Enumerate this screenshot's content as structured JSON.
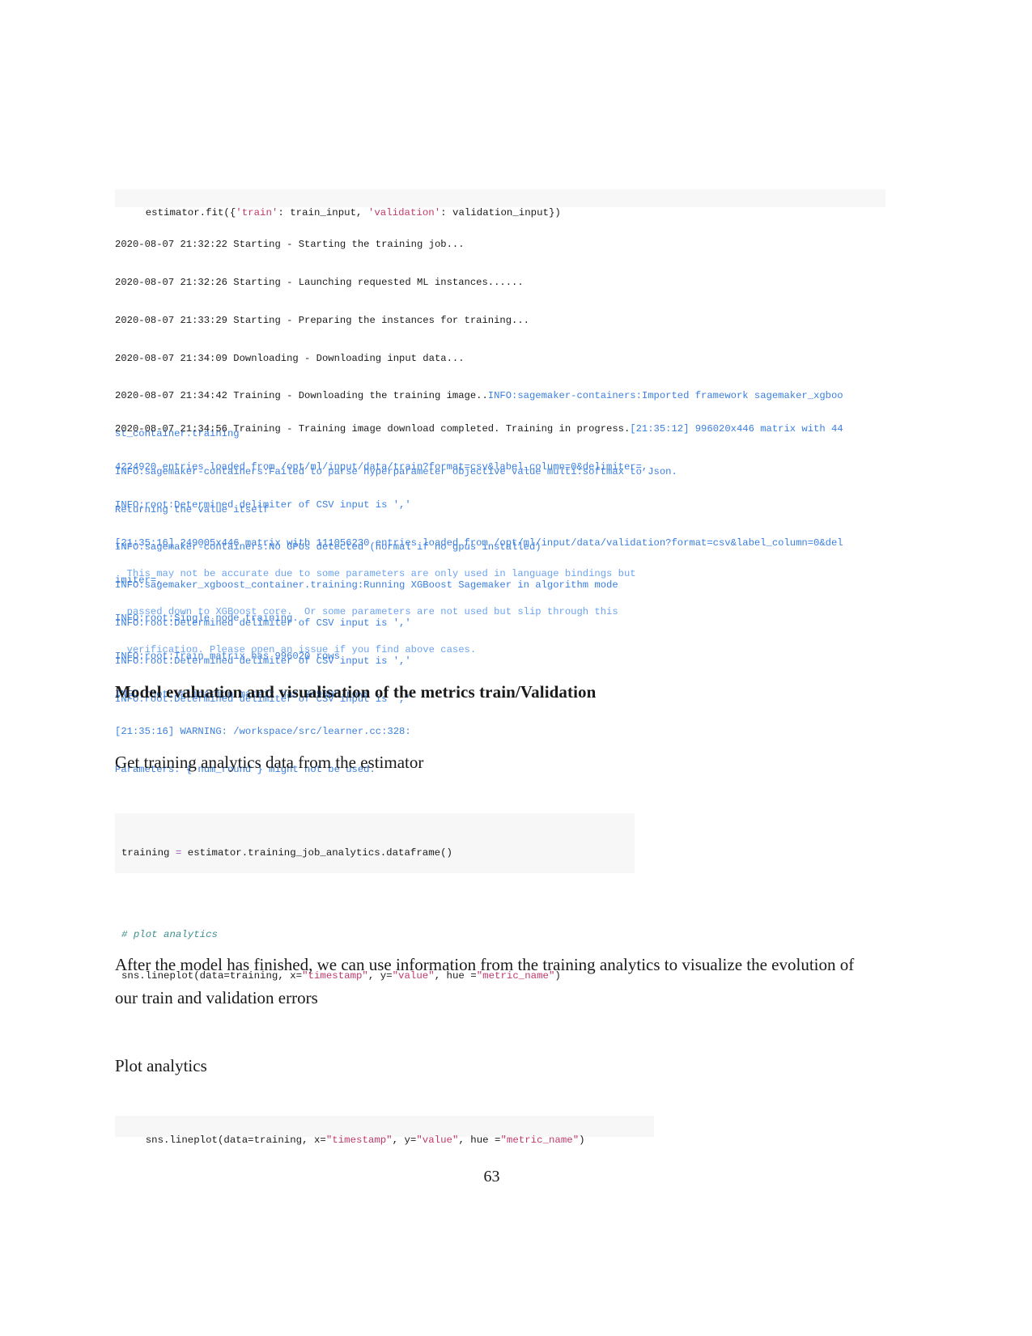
{
  "document": {
    "page_number": "63"
  },
  "cells": {
    "fit_call": {
      "tok_a": "estimator.fit({",
      "tok_train": "'train'",
      "tok_b": ": train_input, ",
      "tok_validation": "'validation'",
      "tok_c": ": validation_input})"
    },
    "analytics": {
      "line1_a": "training ",
      "line1_op": "=",
      "line1_b": " estimator.training_job_analytics.dataframe()",
      "comment": "# plot analytics",
      "line3_a": "sns.lineplot(data=training, x=",
      "line3_s1": "\"timestamp\"",
      "line3_b": ", y=",
      "line3_s2": "\"value\"",
      "line3_c": ", hue =",
      "line3_s3": "\"metric_name\"",
      "line3_d": ")"
    },
    "lineplot": {
      "a": "sns.lineplot(data=training, x=",
      "s1": "\"timestamp\"",
      "b": ", y=",
      "s2": "\"value\"",
      "c": ", hue =",
      "s3": "\"metric_name\"",
      "d": ")"
    }
  },
  "log": {
    "block1": [
      {
        "dark": "2020-08-07 21:32:22 Starting - Starting the training job..."
      },
      {
        "dark": "2020-08-07 21:32:26 Starting - Launching requested ML instances......"
      },
      {
        "dark": "2020-08-07 21:33:29 Starting - Preparing the instances for training..."
      },
      {
        "dark": "2020-08-07 21:34:09 Downloading - Downloading input data..."
      },
      {
        "dark": "2020-08-07 21:34:42 Training - Downloading the training image..",
        "blue": "INFO:sagemaker-containers:Imported framework sagemaker_xgboo"
      },
      {
        "blue": "st_container.training"
      },
      {
        "blue": "INFO:sagemaker-containers:Failed to parse hyperparameter objective value multi:softmax to Json."
      },
      {
        "blue": "Returning the value itself"
      },
      {
        "blue": "INFO:sagemaker-containers:No GPUs detected (normal if no gpus installed)"
      },
      {
        "blue": "INFO:sagemaker_xgboost_container.training:Running XGBoost Sagemaker in algorithm mode"
      },
      {
        "blue": "INFO:root:Determined delimiter of CSV input is ','"
      },
      {
        "blue": "INFO:root:Determined delimiter of CSV input is ','"
      },
      {
        "blue": "INFO:root:Determined delimiter of CSV input is ','"
      }
    ],
    "block2": [
      {
        "dark": "2020-08-07 21:34:56 Training - Training image download completed. Training in progress.",
        "blue": "[21:35:12] 996020x446 matrix with 44"
      },
      {
        "blue": "4224920 entries loaded from /opt/ml/input/data/train?format=csv&label_column=0&delimiter=,"
      },
      {
        "blue": "INFO:root:Determined delimiter of CSV input is ','"
      },
      {
        "blue": "[21:35:16] 249005x446 matrix with 111056230 entries loaded from /opt/ml/input/data/validation?format=csv&label_column=0&del"
      },
      {
        "blue": "imiter=,"
      },
      {
        "blue": "INFO:root:Single node training."
      },
      {
        "blue": "INFO:root:Train matrix has 996020 rows"
      },
      {
        "blue": "INFO:root:Validation matrix has 249005 rows"
      },
      {
        "blue": "[21:35:16] WARNING: /workspace/src/learner.cc:328:"
      },
      {
        "blue": "Parameters: { num_round } might not be used."
      }
    ],
    "block3": [
      {
        "lite": "  This may not be accurate due to some parameters are only used in language bindings but"
      },
      {
        "lite": "  passed down to XGBoost core.  Or some parameters are not used but slip through this"
      },
      {
        "lite": "  verification. Please open an issue if you find above cases."
      }
    ]
  },
  "prose": {
    "heading": "Model evaluation and visualisation of the metrics train/Validation",
    "para_get": "Get training analytics data from the estimator",
    "para_after": "After the model has finished, we can use information from the training analytics to visualize the evolution of our train and validation errors",
    "para_plot": "Plot analytics"
  }
}
